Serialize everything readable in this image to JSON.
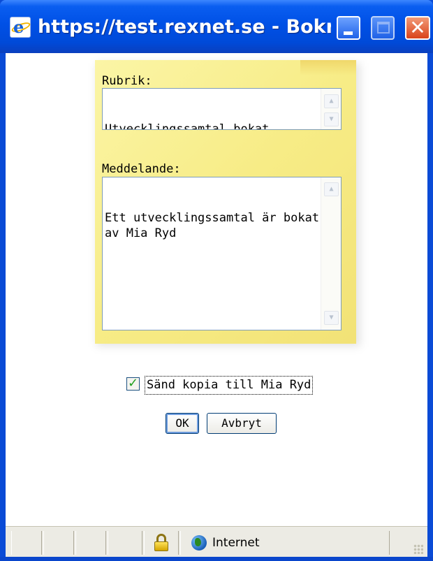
{
  "window": {
    "title": "https://test.rexnet.se - Bokning...",
    "icon": "ie-page-icon",
    "controls": {
      "minimize": "minimize-icon",
      "maximize": "maximize-icon",
      "close": "close-icon",
      "close_glyph": "✕"
    }
  },
  "form": {
    "subject_label": "Rubrik:",
    "subject_value": "Utvecklingssamtal bokat",
    "message_label": "Meddelande:",
    "message_value": "Ett utvecklingssamtal är bokat av Mia Ryd",
    "copy_checked": true,
    "copy_label": "Sänd kopia till Mia Ryd",
    "ok_label": "OK",
    "cancel_label": "Avbryt"
  },
  "statusbar": {
    "security_icon": "lock-icon",
    "zone_icon": "globe-icon",
    "zone_label": "Internet"
  },
  "colors": {
    "titlebar": "#0050e6",
    "note": "#f7ec86",
    "close_button": "#d9431a"
  }
}
